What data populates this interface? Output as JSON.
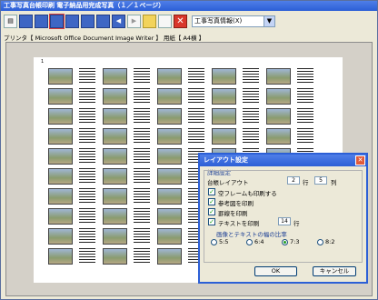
{
  "window": {
    "title": "工事写真台帳印刷 電子納品用完成写真（１／１ページ）"
  },
  "toolbar": {
    "buttons": [
      "printer-icon",
      "layout-1-icon",
      "layout-2-icon",
      "layout-3-icon",
      "layout-4-icon",
      "layout-5-icon",
      "layout-6-icon",
      "prev-page-icon",
      "next-page-icon",
      "zoom-in-icon",
      "zoom-out-icon",
      "close-icon"
    ],
    "close_glyph": "✕",
    "select_value": "工事写真情報(X)"
  },
  "printer_line": "プリンタ【 Microsoft Office Document Image Writer 】 用紙【 A4横 】",
  "page_mark": "1",
  "dialog": {
    "title": "レイアウト設定",
    "close_glyph": "✕",
    "group_label": "詳細設定",
    "layout_label": "台帳レイアウト",
    "rows_value": "2",
    "rows_unit": "行",
    "cols_value": "5",
    "cols_unit": "列",
    "checks": [
      {
        "label": "空フレームも印刷する",
        "checked": true
      },
      {
        "label": "参考図を印刷",
        "checked": true
      },
      {
        "label": "罫線を印刷",
        "checked": true
      },
      {
        "label": "テキストを印刷",
        "checked": true
      }
    ],
    "check_mark": "✓",
    "text_rows_value": "14",
    "text_rows_unit": "行",
    "ratio_label": "画像とテキストの幅の比率",
    "ratios": [
      "5:5",
      "6:4",
      "7:3",
      "8:2"
    ],
    "ratio_selected": "7:3",
    "ok_label": "OK",
    "cancel_label": "キャンセル"
  }
}
